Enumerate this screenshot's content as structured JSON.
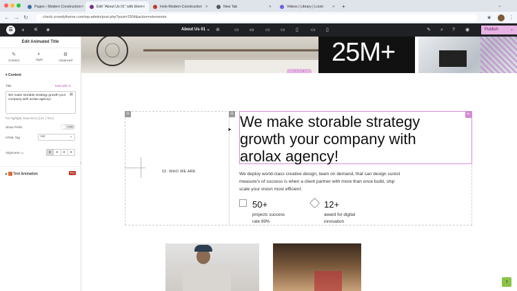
{
  "browser": {
    "tabs": [
      {
        "label": "Pages ‹ Modern Construction",
        "active": false,
        "color": "#3b6ea5"
      },
      {
        "label": "Edit \"About Us 01\" with Elem",
        "active": true,
        "color": "#7a2d8c"
      },
      {
        "label": "Holo-Modern-Construction",
        "active": false,
        "color": "#c0392b"
      },
      {
        "label": "New Tab",
        "active": false,
        "color": "#555555"
      },
      {
        "label": "Videos | Library | Loom",
        "active": false,
        "color": "#6c5ce7"
      }
    ],
    "url": "check.crowdytheme.com/wp-admin/post.php?post=3304&action=elementor"
  },
  "topbar": {
    "page_name": "About Us 01",
    "publish": "Publish"
  },
  "panel": {
    "title": "Edit Animated Title",
    "tabs": [
      "Content",
      "Style",
      "Advanced"
    ],
    "section_content": "Content",
    "title_label": "Title",
    "edit_ai": "Edit with AI",
    "title_value": "We make storable strategy growth your company with arolax agency!",
    "hint": "For Highlight, keep text in [[ Ex. ] Text ]",
    "show_prefix": "Show Prefix",
    "show_prefix_state": "Hide",
    "html_tag": "HTML Tag",
    "html_tag_value": "H2",
    "alignment": "Alignment",
    "text_animation": "Text Animation",
    "pro": "Pro"
  },
  "content": {
    "stat_banner": "25M+",
    "section_label": "02. WHO WE ARE",
    "heading": "We make storable strategy growth your company with arolax agency!",
    "description": "We deploy world-class creative design, team on demand, that can design surest measure's of success is when a client partner with more than once build, ship scale your vision most efficient.",
    "stats": [
      {
        "value": "50+",
        "caption_line1": "projects success",
        "caption_line2": "rate 99%"
      },
      {
        "value": "12+",
        "caption_line1": "award for digital",
        "caption_line2": "innovation"
      }
    ]
  }
}
